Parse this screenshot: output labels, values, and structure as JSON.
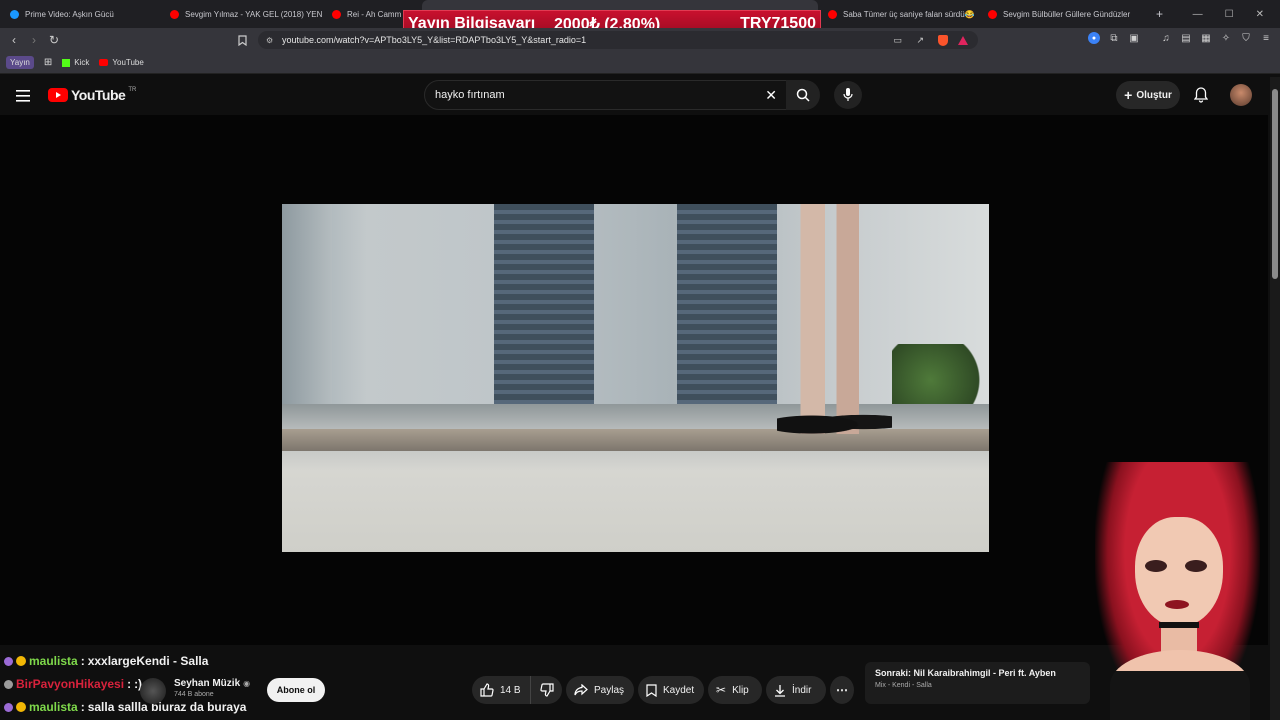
{
  "tabs": [
    {
      "title": "Prime Video: Aşkın Gücü",
      "color": "#1a98ff"
    },
    {
      "title": "Sevgim Yılmaz - YAK GEL (2018) YEN",
      "color": "#ff0000"
    },
    {
      "title": "Rei - Ah Camm",
      "color": "#ff0000"
    },
    {
      "title": "Saba Tümer üç saniye falan sürdü😂",
      "color": "#ff0000"
    },
    {
      "title": "Sevgim Bülbüller Güllere Gündüzler",
      "color": "#ff0000"
    }
  ],
  "overlay": {
    "left": "Yayın Bilgisayarı",
    "middle": "2000₺ (2.80%)",
    "right": "TRY71500"
  },
  "browser": {
    "url": "youtube.com/watch?v=APTbo3LY5_Y&list=RDAPTbo3LY5_Y&start_radio=1",
    "bookmarks": [
      {
        "label": "Yayın",
        "type": "pill"
      },
      {
        "label": "Kick",
        "color": "#53fc18"
      },
      {
        "label": "YouTube",
        "color": "#ff0000"
      }
    ]
  },
  "youtube": {
    "logo_text": "YouTube",
    "region": "TR",
    "search_value": "hayko fırtınam",
    "create_label": "Oluştur"
  },
  "chat": [
    {
      "user": "maulista",
      "message": "xxxlargeKendi - Salla",
      "user_color": "#7fd94b",
      "msg_color": "#f1f1f1"
    },
    {
      "user": "BirPavyonHikayesi",
      "message": ":)",
      "user_color": "#d8223c",
      "msg_color": "#f1f1f1"
    },
    {
      "user": "maulista",
      "message": "salla sallla biuraz da buraya",
      "user_color": "#7fd94b",
      "msg_color": "#f1f1f1"
    }
  ],
  "channel": {
    "name": "Seyhan Müzik",
    "subs": "744 B abone",
    "subscribe_label": "Abone ol"
  },
  "actions": {
    "likes": "14 B",
    "share": "Paylaş",
    "save": "Kaydet",
    "clip": "Klip",
    "download": "İndir"
  },
  "next": {
    "title": "Sonraki: Nil Karaibrahimgil - Peri ft. Ayben",
    "subtitle": "Mix - Kendi - Salla"
  }
}
